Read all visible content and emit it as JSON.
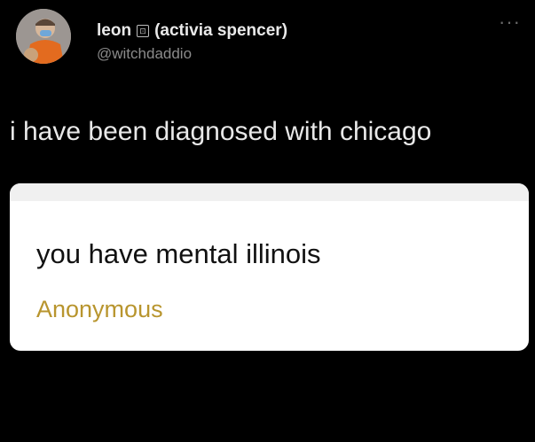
{
  "tweet": {
    "author_name": "leon",
    "author_display_suffix": "(activia spencer)",
    "name_glyph": "⊡",
    "handle": "@witchdaddio",
    "more_label": "···",
    "text": "i have been diagnosed with chicago"
  },
  "card": {
    "question": "you have mental illinois",
    "author": "Anonymous",
    "author_color": "#b8952e"
  },
  "icons": {
    "avatar": "profile-photo",
    "more": "more-options-icon"
  }
}
